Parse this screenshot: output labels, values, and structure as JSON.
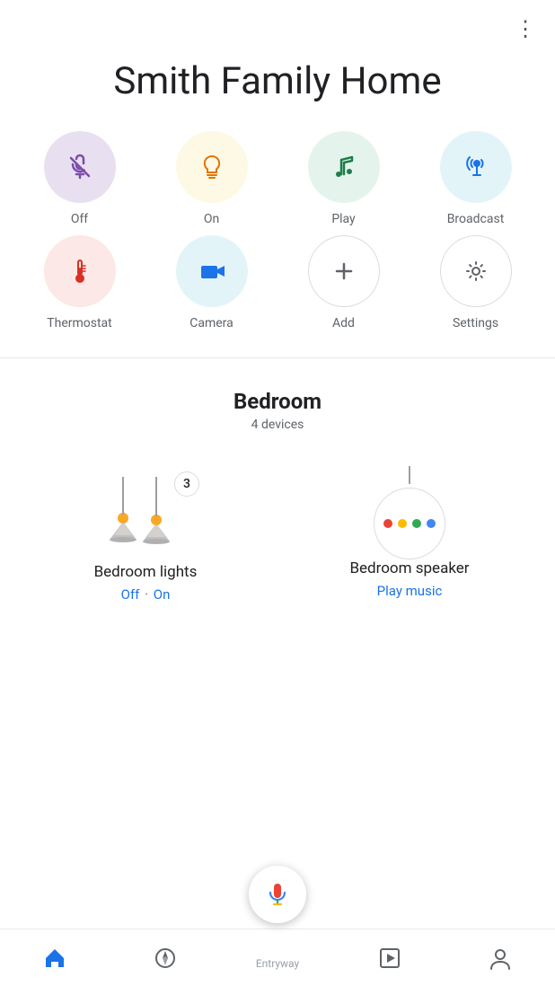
{
  "header": {
    "more_icon": "⋮"
  },
  "home": {
    "title": "Smith Family Home"
  },
  "actions": [
    {
      "id": "off",
      "label": "Off",
      "circle_class": "circle-off"
    },
    {
      "id": "on",
      "label": "On",
      "circle_class": "circle-on"
    },
    {
      "id": "play",
      "label": "Play",
      "circle_class": "circle-play"
    },
    {
      "id": "broadcast",
      "label": "Broadcast",
      "circle_class": "circle-broadcast"
    },
    {
      "id": "thermostat",
      "label": "Thermostat",
      "circle_class": "circle-thermostat"
    },
    {
      "id": "camera",
      "label": "Camera",
      "circle_class": "circle-camera"
    },
    {
      "id": "add",
      "label": "Add",
      "circle_class": "circle-add"
    },
    {
      "id": "settings",
      "label": "Settings",
      "circle_class": "circle-settings"
    }
  ],
  "room": {
    "name": "Bedroom",
    "device_count": "4 devices"
  },
  "devices": [
    {
      "id": "bedroom-lights",
      "name": "Bedroom lights",
      "status_off": "Off",
      "status_on": "On",
      "badge": "3"
    },
    {
      "id": "bedroom-speaker",
      "name": "Bedroom speaker",
      "action": "Play music"
    }
  ],
  "bottom_nav": [
    {
      "id": "home",
      "label": "Home"
    },
    {
      "id": "explore",
      "label": "Explore"
    },
    {
      "id": "media",
      "label": "Media"
    },
    {
      "id": "profile",
      "label": "Profile"
    }
  ],
  "entryway_label": "Entryway"
}
